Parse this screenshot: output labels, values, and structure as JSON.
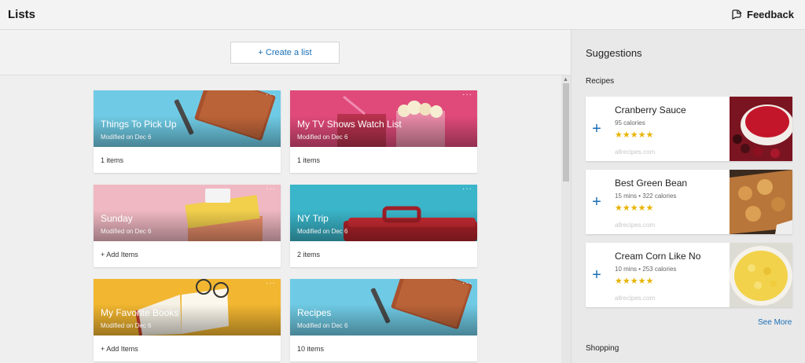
{
  "app": {
    "title": "Lists",
    "feedback_label": "Feedback"
  },
  "toolbar": {
    "create_label": "+ Create a list"
  },
  "lists": [
    {
      "title": "Things To Pick Up",
      "modified": "Modified on Dec 6",
      "footer": "1 items",
      "more": "···"
    },
    {
      "title": "My TV Shows Watch List",
      "modified": "Modified on Dec 6",
      "footer": "1 items",
      "more": "···"
    },
    {
      "title": "Sunday",
      "modified": "Modified on Dec 6",
      "footer": "+ Add Items",
      "more": "···"
    },
    {
      "title": "NY Trip",
      "modified": "Modified on Dec 6",
      "footer": "2 items",
      "more": "···"
    },
    {
      "title": "My Favorite Books",
      "modified": "Modified on Dec 6",
      "footer": "+ Add Items",
      "more": "···"
    },
    {
      "title": "Recipes",
      "modified": "Modified on Dec 6",
      "footer": "10 items",
      "more": "···"
    }
  ],
  "suggestions": {
    "title": "Suggestions",
    "recipes_heading": "Recipes",
    "items": [
      {
        "name": "Cranberry Sauce",
        "meta": "95 calories",
        "stars": "★★★★★",
        "rating": 4.5,
        "source": "allrecipes.com",
        "add": "+"
      },
      {
        "name": "Best Green Bean",
        "meta": "15 mins • 322 calories",
        "stars": "★★★★★",
        "rating": 4.5,
        "source": "allrecipes.com",
        "add": "+"
      },
      {
        "name": "Cream Corn Like No",
        "meta": "10 mins • 253 calories",
        "stars": "★★★★★",
        "rating": 4.5,
        "source": "allrecipes.com",
        "add": "+"
      }
    ],
    "see_more": "See More",
    "shopping_heading": "Shopping"
  },
  "colors": {
    "accent": "#1a6fb6",
    "star": "#e8b400"
  }
}
